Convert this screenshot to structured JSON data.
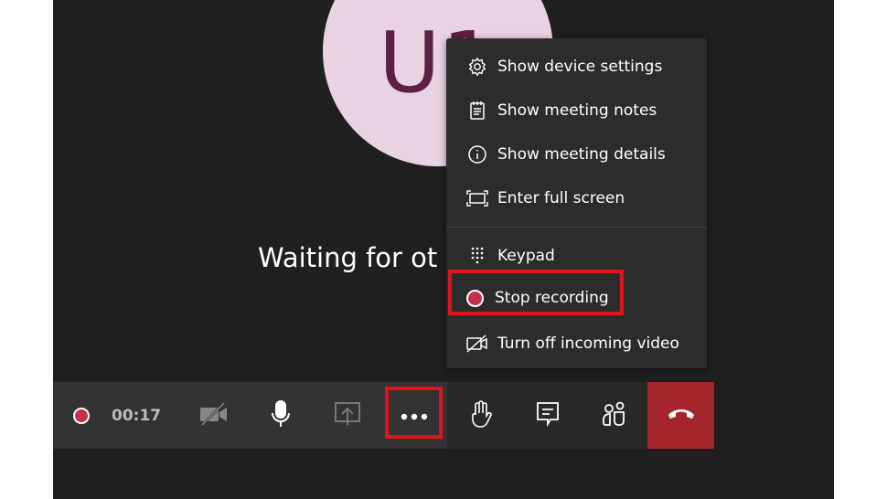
{
  "avatar": {
    "initials": "U1",
    "bg": "#e9d3e3",
    "fg": "#5c2045"
  },
  "status_text": "Waiting for ot",
  "menu": {
    "items": [
      {
        "label": "Show device settings",
        "icon": "gear-icon"
      },
      {
        "label": "Show meeting notes",
        "icon": "notes-icon"
      },
      {
        "label": "Show meeting details",
        "icon": "info-icon"
      },
      {
        "label": "Enter full screen",
        "icon": "fullscreen-icon"
      },
      {
        "label": "Keypad",
        "icon": "keypad-icon"
      },
      {
        "label": "Stop recording",
        "icon": "record-icon"
      },
      {
        "label": "Turn off incoming video",
        "icon": "video-off-icon"
      }
    ]
  },
  "toolbar": {
    "recording_time": "00:17",
    "hangup_color": "#a4262c",
    "record_color": "#c4314b",
    "highlight_color": "#e0141e"
  }
}
